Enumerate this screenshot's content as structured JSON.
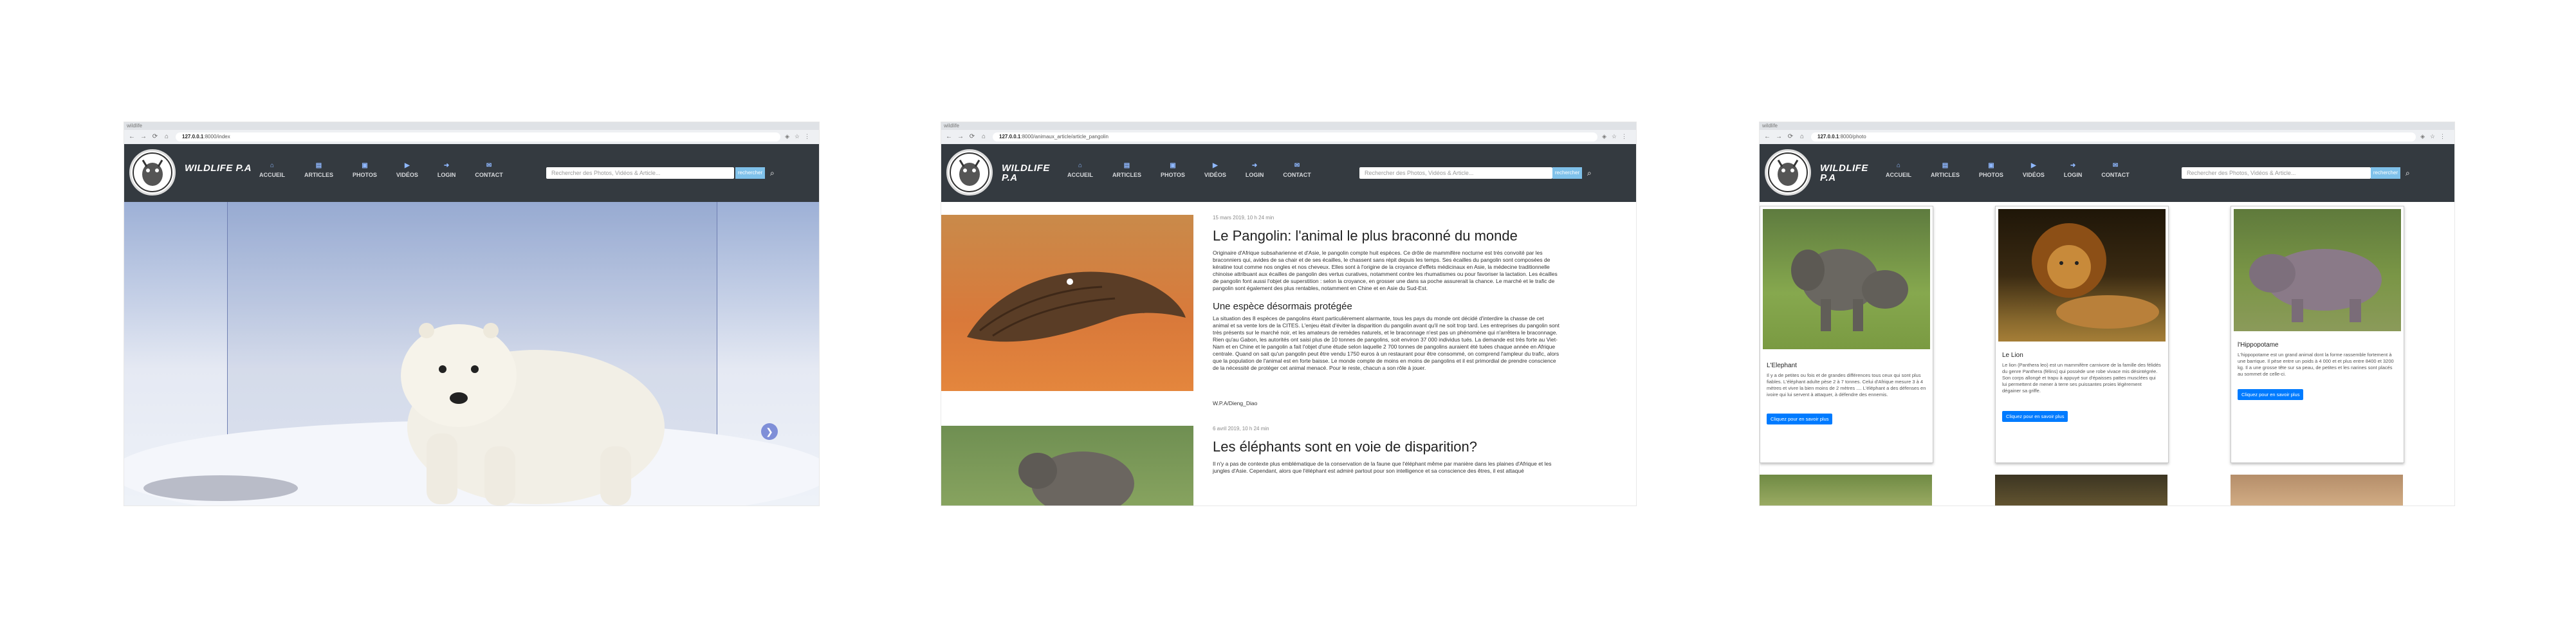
{
  "common": {
    "tab_title": "wildlife",
    "brand": "WILDLIFE P.A",
    "menu": [
      {
        "label": "ACCUEIL",
        "icon": "home-icon"
      },
      {
        "label": "ARTICLES",
        "icon": "articles-icon"
      },
      {
        "label": "PHOTOS",
        "icon": "photos-icon"
      },
      {
        "label": "VIDÉOS",
        "icon": "videos-icon"
      },
      {
        "label": "LOGIN",
        "icon": "login-icon"
      },
      {
        "label": "CONTACT",
        "icon": "contact-icon"
      }
    ],
    "search_placeholder": "Rechercher des Photos, Vidéos & Article...",
    "search_button": "rechercher",
    "accent": "#343a40",
    "button_color": "#007bff"
  },
  "shot1": {
    "url_host": "127.0.0.1",
    "url_path": ":8000/index"
  },
  "shot2": {
    "url_host": "127.0.0.1",
    "url_path": ":8000/animaux_article/article_pangolin",
    "articles": [
      {
        "date": "15 mars 2019, 10 h 24 min",
        "title": "Le Pangolin: l'animal le plus braconné du monde",
        "paragraph1": "Originaire d'Afrique subsaharienne et d'Asie, le pangolin compte huit espèces. Ce drôle de mammifère nocturne est très convoité par les braconniers qui, avides de sa chair et de ses écailles, le chassent sans répit depuis les temps. Ses écailles du pangolin sont composées de kératine tout comme nos ongles et nos cheveux. Elles sont à l'origine de la croyance d'effets médicinaux en Asie, la médecine traditionnelle chinoise attribuant aux écailles de pangolin des vertus curatives, notamment contre les rhumatismes ou pour favoriser la lactation. Les écailles de pangolin font aussi l'objet de superstition : selon la croyance, en grosser une dans sa poche assurerait la chance. Le marché et le trafic de pangolin sont également des plus rentables, notamment en Chine et en Asie du Sud-Est.",
        "subtitle": "Une espèce désormais protégée",
        "paragraph2": "La situation des 8 espèces de pangolins étant particulièrement alarmante, tous les pays du monde ont décidé d'interdire la chasse de cet animal et sa vente lors de la CITES. L'enjeu était d'éviter la disparition du pangolin avant qu'il ne soit trop tard. Les entreprises du pangolin sont très présents sur le marché noir, et les amateurs de remèdes naturels, et le braconnage n'est pas un phénomène qui n'arrêtera le braconnage. Rien qu'au Gabon, les autorités ont saisi plus de 10 tonnes de pangolins, soit environ 37 000 individus tués. La demande est très forte au Viet-Nam et en Chine et le pangolin a fait l'objet d'une étude selon laquelle 2 700 tonnes de pangolins auraient été tuées chaque année en Afrique centrale. Quand on sait qu'un pangolin peut être vendu 1750 euros à un restaurant pour être consommé, on comprend l'ampleur du trafic, alors que la population de l'animal est en forte baisse. Le monde compte de moins en moins de pangolins et il est primordial de prendre conscience de la nécessité de protéger cet animal menacé. Pour le reste, chacun a son rôle à jouer.",
        "signature": "W.P.A/Dieng_Diao"
      },
      {
        "date": "6 avril 2019, 10 h 24 min",
        "title": "Les éléphants sont en voie de disparition?",
        "paragraph1": "Il n'y a pas de contexte plus emblématique de la conservation de la faune que l'éléphant même par manière dans les plaines d'Afrique et les jungles d'Asie. Cependant, alors que l'éléphant est admiré partout pour son intelligence et sa conscience des êtres, il est attaqué"
      }
    ]
  },
  "shot3": {
    "url_host": "127.0.0.1",
    "url_path": ":8000/photo",
    "cards": [
      {
        "title": "L'Elephant",
        "text": "Il y a de petites ou fois et de grandes différences tous ceux qui sont plus fiables. L'éléphant adulte pèse 2 à 7 tonnes. Celui d'Afrique mesure 3 à 4 mètres et vivre la bien moins de 2 mètres .... L'éléphant a des défenses en ivoire qui lui servent à attaquer, à défendre des ennemis.",
        "button": "Cliquez pour en savoir plus"
      },
      {
        "title": "Le Lion",
        "text": "Le lion (Panthera leo) est un mammifère carnivore de la famille des félidés du genre Panthera (félins) qui possède une robe vivace mis désintégrée. Son corps allongé et trapu à appuyé sur d'épaisses pattes musclées qui lui permettent de mener à terre ses puissantes proies légèrement dégainer sa griffe.",
        "button": "Cliquez pour en savoir plus"
      },
      {
        "title": "l'Hippopotame",
        "text": "L'hippopotame est un grand animal dont la forme rassemble fortement à une barrique. Il pèse entre un poids à 4 000 et et plus entre 8400 et 3200 kg. Il a une grosse tête sur sa peau, de petites et les narines sont placés au sommet de celle-ci.",
        "button": "Cliquez pour en savoir plus"
      }
    ]
  }
}
